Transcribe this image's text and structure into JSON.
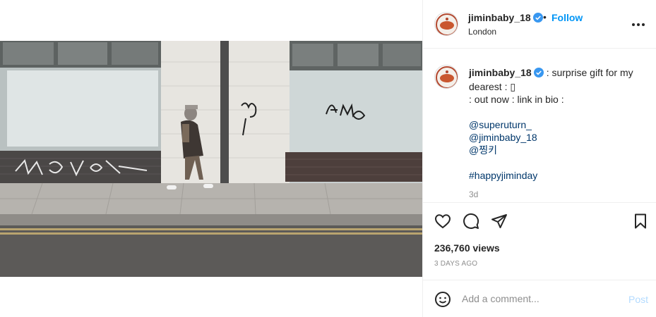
{
  "header": {
    "username": "jiminbaby_18",
    "separator": "•",
    "follow_label": "Follow",
    "location": "London"
  },
  "caption": {
    "username": "jiminbaby_18",
    "line1": ": surprise gift for my dearest : ",
    "line1_glyph": "▯",
    "line2": ": out now : link in bio :",
    "mentions": [
      "@superuturn_",
      "@jiminbaby_18",
      "@찡키"
    ],
    "hashtag": "#happyjiminday",
    "time": "3d"
  },
  "stats": {
    "views": "236,760 views",
    "date": "3 DAYS AGO"
  },
  "comment": {
    "placeholder": "Add a comment...",
    "post_label": "Post"
  },
  "icons": {
    "verified": "verified-badge-icon",
    "more": "more-options-icon",
    "like": "heart-icon",
    "comment": "comment-bubble-icon",
    "share": "paper-plane-icon",
    "save": "bookmark-icon",
    "emoji": "smiley-icon"
  },
  "colors": {
    "accent": "#0095f6",
    "verified": "#3897f0",
    "link": "#00376b",
    "muted": "#8e8e8e",
    "post_disabled": "#b3dbff"
  }
}
